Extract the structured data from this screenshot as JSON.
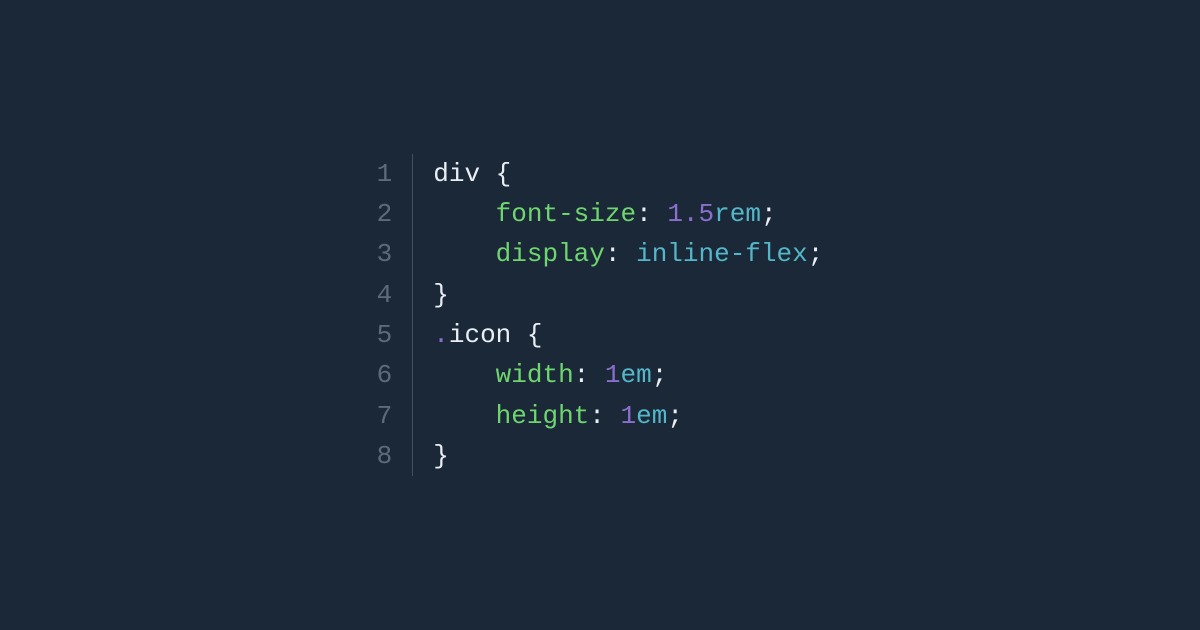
{
  "code": {
    "language": "css",
    "line_numbers": [
      "1",
      "2",
      "3",
      "4",
      "5",
      "6",
      "7",
      "8"
    ],
    "lines": [
      {
        "indent": 0,
        "tokens": [
          {
            "t": "div ",
            "c": "tok-selector"
          },
          {
            "t": "{",
            "c": "tok-brace"
          }
        ]
      },
      {
        "indent": 1,
        "tokens": [
          {
            "t": "font-size",
            "c": "tok-prop"
          },
          {
            "t": ":",
            "c": "tok-colon"
          },
          {
            "t": " ",
            "c": "tok-default"
          },
          {
            "t": "1",
            "c": "tok-num"
          },
          {
            "t": ".",
            "c": "tok-dot"
          },
          {
            "t": "5",
            "c": "tok-num"
          },
          {
            "t": "rem",
            "c": "tok-unit"
          },
          {
            "t": ";",
            "c": "tok-punct"
          }
        ]
      },
      {
        "indent": 1,
        "tokens": [
          {
            "t": "display",
            "c": "tok-prop"
          },
          {
            "t": ":",
            "c": "tok-colon"
          },
          {
            "t": " ",
            "c": "tok-default"
          },
          {
            "t": "inline-flex",
            "c": "tok-value"
          },
          {
            "t": ";",
            "c": "tok-punct"
          }
        ]
      },
      {
        "indent": 0,
        "tokens": [
          {
            "t": "}",
            "c": "tok-brace"
          }
        ]
      },
      {
        "indent": 0,
        "tokens": [
          {
            "t": ".",
            "c": "tok-dot"
          },
          {
            "t": "icon ",
            "c": "tok-classname"
          },
          {
            "t": "{",
            "c": "tok-brace"
          }
        ]
      },
      {
        "indent": 1,
        "tokens": [
          {
            "t": "width",
            "c": "tok-prop"
          },
          {
            "t": ":",
            "c": "tok-colon"
          },
          {
            "t": " ",
            "c": "tok-default"
          },
          {
            "t": "1",
            "c": "tok-num"
          },
          {
            "t": "em",
            "c": "tok-unit"
          },
          {
            "t": ";",
            "c": "tok-punct"
          }
        ]
      },
      {
        "indent": 1,
        "tokens": [
          {
            "t": "height",
            "c": "tok-prop"
          },
          {
            "t": ":",
            "c": "tok-colon"
          },
          {
            "t": " ",
            "c": "tok-default"
          },
          {
            "t": "1",
            "c": "tok-num"
          },
          {
            "t": "em",
            "c": "tok-unit"
          },
          {
            "t": ";",
            "c": "tok-punct"
          }
        ]
      },
      {
        "indent": 0,
        "tokens": [
          {
            "t": "}",
            "c": "tok-brace"
          }
        ]
      }
    ]
  }
}
